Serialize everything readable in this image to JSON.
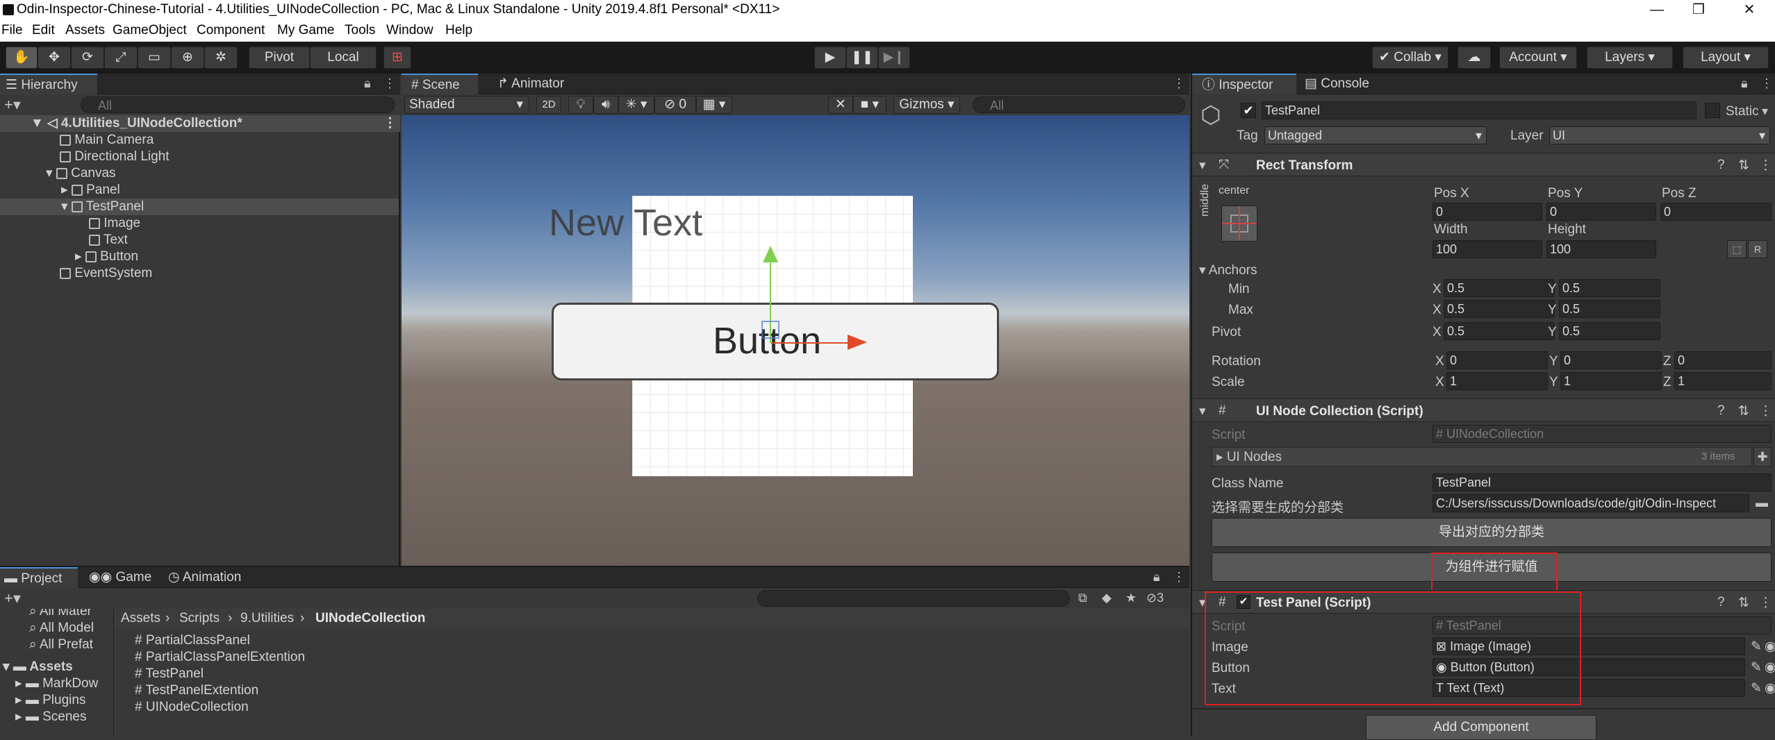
{
  "window": {
    "title": "Odin-Inspector-Chinese-Tutorial - 4.Utilities_UINodeCollection - PC, Mac & Linux Standalone - Unity 2019.4.8f1 Personal* <DX11>"
  },
  "menu": [
    "File",
    "Edit",
    "Assets",
    "GameObject",
    "Component",
    "My Game",
    "Tools",
    "Window",
    "Help"
  ],
  "toolbar": {
    "pivot": "Pivot",
    "local": "Local",
    "collab": "Collab",
    "account": "Account",
    "layers": "Layers",
    "layout": "Layout"
  },
  "hierarchy": {
    "tab": "Hierarchy",
    "search_placeholder": "All",
    "scene": "4.Utilities_UINodeCollection*",
    "items": [
      {
        "label": "Main Camera"
      },
      {
        "label": "Directional Light"
      },
      {
        "label": "Canvas"
      },
      {
        "label": "Panel"
      },
      {
        "label": "TestPanel"
      },
      {
        "label": "Image"
      },
      {
        "label": "Text"
      },
      {
        "label": "Button"
      },
      {
        "label": "EventSystem"
      }
    ]
  },
  "scene_view": {
    "tabs": [
      "Scene",
      "Animator"
    ],
    "shading": "Shaded",
    "mode_2d": "2D",
    "hidden_count": "0",
    "gizmos": "Gizmos",
    "search_placeholder": "All",
    "new_text": "New Text",
    "button_text": "Button"
  },
  "project": {
    "tabs": [
      "Project",
      "Game",
      "Animation"
    ],
    "count": "3",
    "favorites": [
      "All Mater",
      "All Model",
      "All Prefat"
    ],
    "tree": [
      "Assets",
      "MarkDow",
      "Plugins",
      "Scenes"
    ],
    "breadcrumb": [
      "Assets",
      "Scripts",
      "9.Utilities",
      "UINodeCollection"
    ],
    "files": [
      "PartialClassPanel",
      "PartialClassPanelExtention",
      "TestPanel",
      "TestPanelExtention",
      "UINodeCollection"
    ]
  },
  "inspector": {
    "tabs": [
      "Inspector",
      "Console"
    ],
    "object_name": "TestPanel",
    "static": "Static",
    "tag_label": "Tag",
    "tag": "Untagged",
    "layer_label": "Layer",
    "layer": "UI",
    "rect_transform": {
      "title": "Rect Transform",
      "anchor_h": "center",
      "anchor_v": "middle",
      "posx_label": "Pos X",
      "posy_label": "Pos Y",
      "posz_label": "Pos Z",
      "posx": "0",
      "posy": "0",
      "posz": "0",
      "width_label": "Width",
      "height_label": "Height",
      "width": "100",
      "height": "100",
      "anchors": "Anchors",
      "min": "Min",
      "max": "Max",
      "pivot": "Pivot",
      "min_x": "0.5",
      "min_y": "0.5",
      "max_x": "0.5",
      "max_y": "0.5",
      "pivot_x": "0.5",
      "pivot_y": "0.5",
      "rotation": "Rotation",
      "scale": "Scale",
      "rot_x": "0",
      "rot_y": "0",
      "rot_z": "0",
      "scale_x": "1",
      "scale_y": "1",
      "scale_z": "1",
      "x": "X",
      "y": "Y",
      "z": "Z",
      "r": "R"
    },
    "ui_node_collection": {
      "title": "UI Node Collection (Script)",
      "script_label": "Script",
      "script": "UINodeCollection",
      "ui_nodes": "UI Nodes",
      "items_count": "3 items",
      "class_name_label": "Class Name",
      "class_name": "TestPanel",
      "partial_label": "选择需要生成的分部类",
      "partial_path": "C:/Users/isscuss/Downloads/code/git/Odin-Inspect",
      "export_button": "导出对应的分部类",
      "assign_button": "为组件进行赋值"
    },
    "test_panel": {
      "title": "Test Panel (Script)",
      "script_label": "Script",
      "script": "TestPanel",
      "image_label": "Image",
      "image": "Image (Image)",
      "button_label": "Button",
      "button": "Button (Button)",
      "text_label": "Text",
      "text": "Text (Text)"
    },
    "add_component": "Add Component"
  },
  "colors": {
    "highlight": "#e02020",
    "accent": "#4a90d9"
  }
}
